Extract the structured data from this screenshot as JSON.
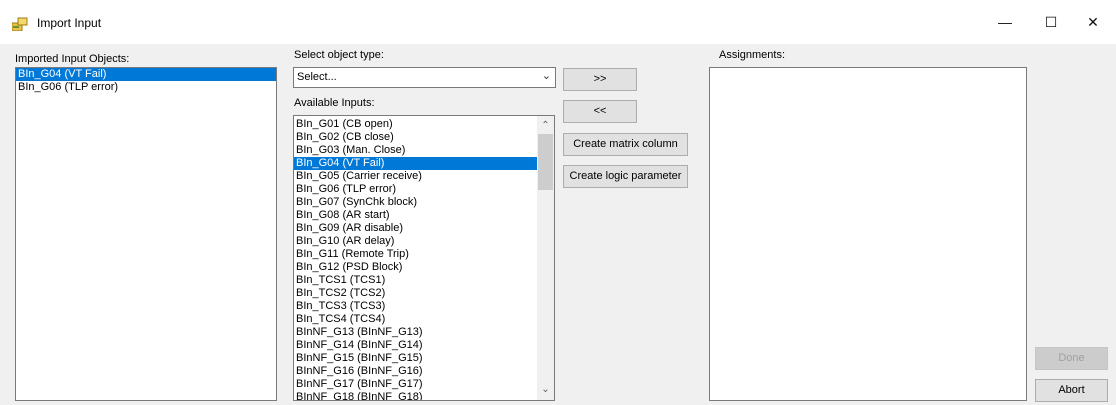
{
  "window": {
    "title": "Import Input",
    "icon": "import-input-app-icon",
    "minimize": "—",
    "maximize": "☐",
    "close": "✕"
  },
  "imported": {
    "label": "Imported Input Objects:",
    "items": [
      {
        "text": "BIn_G04 (VT Fail)",
        "selected": true
      },
      {
        "text": "BIn_G06 (TLP error)",
        "selected": false
      }
    ]
  },
  "select_type": {
    "label": "Select object type:",
    "value": "Select..."
  },
  "available": {
    "label": "Available Inputs:",
    "items": [
      {
        "text": "BIn_G01 (CB open)",
        "selected": false
      },
      {
        "text": "BIn_G02 (CB close)",
        "selected": false
      },
      {
        "text": "BIn_G03 (Man. Close)",
        "selected": false
      },
      {
        "text": "BIn_G04 (VT Fail)",
        "selected": true
      },
      {
        "text": "BIn_G05 (Carrier receive)",
        "selected": false
      },
      {
        "text": "BIn_G06 (TLP error)",
        "selected": false
      },
      {
        "text": "BIn_G07 (SynChk block)",
        "selected": false
      },
      {
        "text": "BIn_G08 (AR start)",
        "selected": false
      },
      {
        "text": "BIn_G09 (AR disable)",
        "selected": false
      },
      {
        "text": "BIn_G10 (AR delay)",
        "selected": false
      },
      {
        "text": "BIn_G11 (Remote Trip)",
        "selected": false
      },
      {
        "text": "BIn_G12 (PSD Block)",
        "selected": false
      },
      {
        "text": "BIn_TCS1 (TCS1)",
        "selected": false
      },
      {
        "text": "BIn_TCS2 (TCS2)",
        "selected": false
      },
      {
        "text": "BIn_TCS3 (TCS3)",
        "selected": false
      },
      {
        "text": "BIn_TCS4 (TCS4)",
        "selected": false
      },
      {
        "text": "BInNF_G13 (BInNF_G13)",
        "selected": false
      },
      {
        "text": "BInNF_G14 (BInNF_G14)",
        "selected": false
      },
      {
        "text": "BInNF_G15 (BInNF_G15)",
        "selected": false
      },
      {
        "text": "BInNF_G16 (BInNF_G16)",
        "selected": false
      },
      {
        "text": "BInNF_G17 (BInNF_G17)",
        "selected": false
      },
      {
        "text": "BInNF_G18 (BInNF_G18)",
        "selected": false
      }
    ]
  },
  "buttons": {
    "add": ">>",
    "remove": "<<",
    "create_matrix": "Create matrix column",
    "create_logic": "Create logic parameter",
    "done": "Done",
    "abort": "Abort"
  },
  "assignments": {
    "label": "Assignments:",
    "items": []
  }
}
